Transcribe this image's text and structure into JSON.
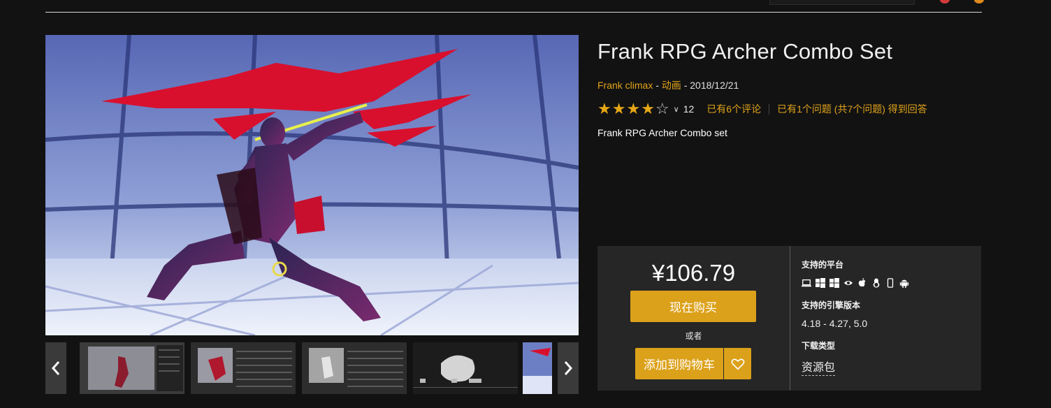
{
  "colors": {
    "background": "#121212",
    "accent": "#e0a31a",
    "button": "#dca11a",
    "panel": "#262626"
  },
  "product": {
    "title": "Frank RPG Archer Combo Set",
    "author": "Frank climax",
    "category": "动画",
    "date": "2018/12/21",
    "rating": 4.5,
    "rating_max": 5,
    "rating_count": "12",
    "reviews_link": "已有6个评论",
    "questions_link": "已有1个问题 (共7个问题) 得到回答",
    "description": "Frank RPG Archer Combo set"
  },
  "meta_sep1": " - ",
  "meta_sep2": " - ",
  "purchase": {
    "price": "¥106.79",
    "buy_now": "现在购买",
    "or": "或者",
    "add_to_cart": "添加到购物车",
    "platforms_label": "支持的平台",
    "platforms": [
      "laptop-icon",
      "windows-icon",
      "windows-store-icon",
      "eye-icon",
      "apple-icon",
      "linux-icon",
      "phone-icon",
      "android-icon"
    ],
    "engine_label": "支持的引擎版本",
    "engine_versions": "4.18 - 4.27, 5.0",
    "download_label": "下载类型",
    "download_type": "资源包"
  },
  "gallery": {
    "prev_icon": "chevron-left-icon",
    "next_icon": "chevron-right-icon",
    "thumb_count": 5
  }
}
